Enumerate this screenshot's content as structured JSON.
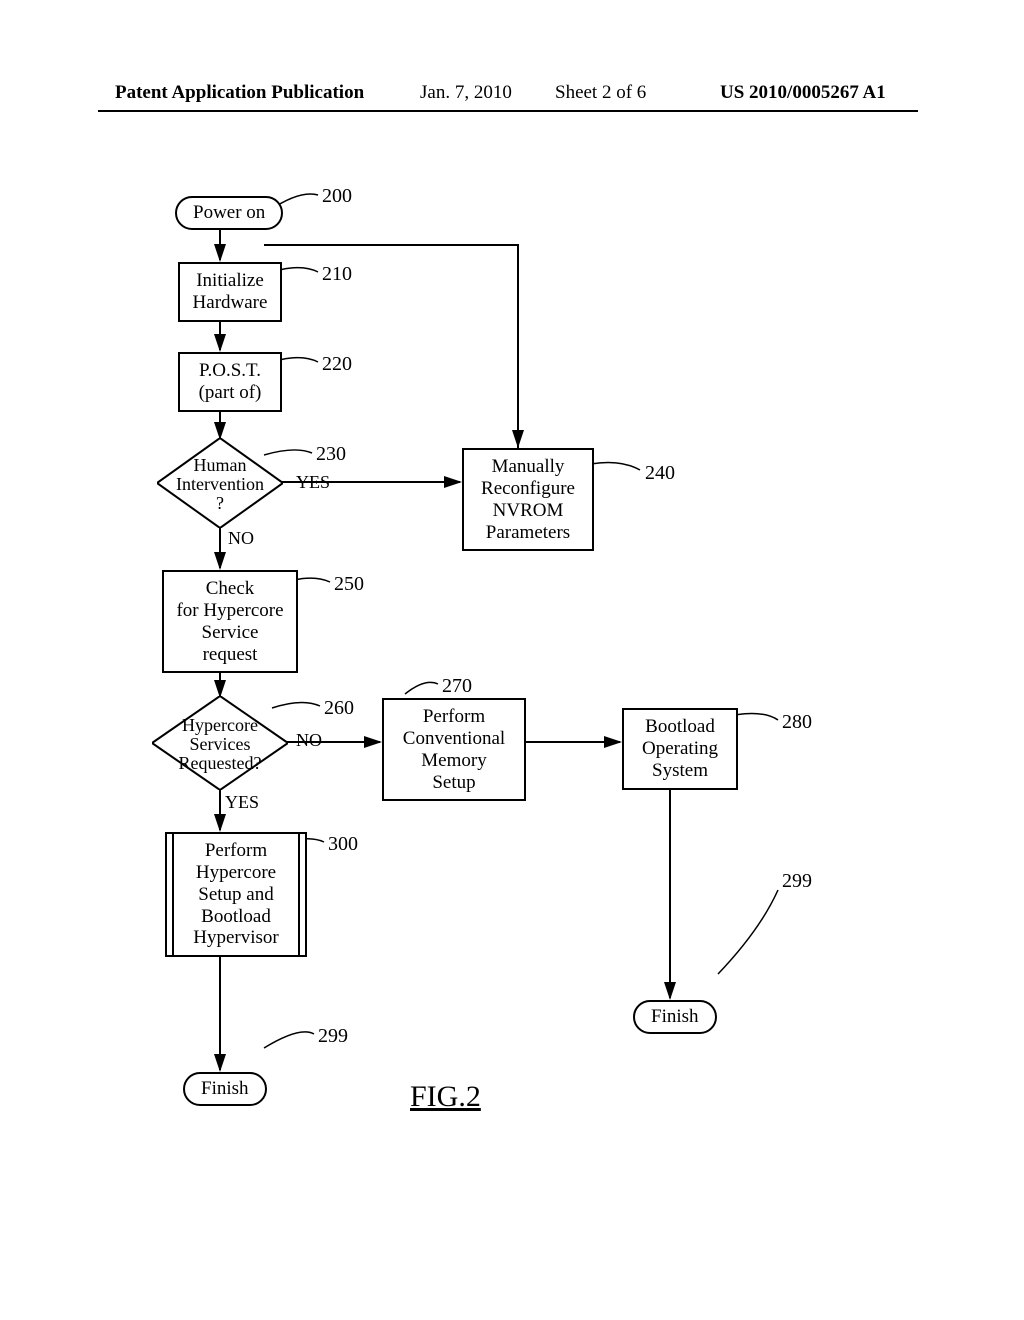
{
  "header": {
    "pub_type": "Patent Application Publication",
    "date": "Jan. 7, 2010",
    "sheet": "Sheet 2 of 6",
    "pubnum": "US 2010/0005267 A1"
  },
  "figure_caption": "FIG.2",
  "nodes": {
    "n200": {
      "text": "Power on",
      "ref": "200"
    },
    "n210": {
      "text": "Initialize\nHardware",
      "ref": "210"
    },
    "n220": {
      "text": "P.O.S.T.\n(part of)",
      "ref": "220"
    },
    "n230": {
      "text": "Human\nIntervention\n?",
      "ref": "230",
      "yes": "YES",
      "no": "NO"
    },
    "n240": {
      "text": "Manually\nReconfigure\nNVROM\nParameters",
      "ref": "240"
    },
    "n250": {
      "text": "Check\nfor Hypercore\nService\nrequest",
      "ref": "250"
    },
    "n260": {
      "text": "Hypercore\nServices\nRequested?",
      "ref": "260",
      "yes": "YES",
      "no": "NO"
    },
    "n270": {
      "text": "Perform\nConventional\nMemory\nSetup",
      "ref": "270"
    },
    "n280": {
      "text": "Bootload\nOperating\nSystem",
      "ref": "280"
    },
    "n300": {
      "text": "Perform\nHypercore\nSetup and\nBootload\nHypervisor",
      "ref": "300"
    },
    "n299a": {
      "text": "Finish",
      "ref": "299"
    },
    "n299b": {
      "text": "Finish",
      "ref": "299"
    }
  }
}
